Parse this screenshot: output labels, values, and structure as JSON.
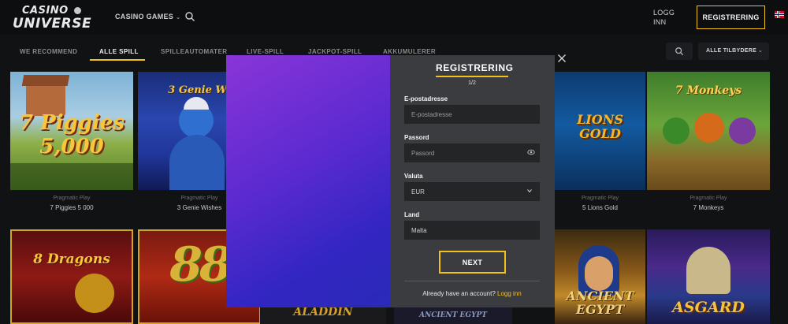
{
  "header": {
    "logo_line1": "CASINO",
    "logo_line2": "UNIVERSE",
    "nav_games": "CASINO GAMES",
    "login": "LOGG INN",
    "register": "REGISTRERING"
  },
  "tabs": [
    {
      "label": "WE RECOMMEND"
    },
    {
      "label": "ALLE SPILL",
      "active": true
    },
    {
      "label": "SPILLEAUTOMATER"
    },
    {
      "label": "LIVE-SPILL"
    },
    {
      "label": "JACKPOT-SPILL"
    },
    {
      "label": "AKKUMULERER"
    }
  ],
  "providers_filter": "ALLE TILBYDERE",
  "games": [
    {
      "provider": "Pragmatic Play",
      "name": "7 Piggies 5 000",
      "art": "7 Piggies 5,000"
    },
    {
      "provider": "Pragmatic Play",
      "name": "3 Genie Wishes",
      "art": "3 Genie Wi"
    },
    {
      "provider": "Pragmatic Play",
      "name": "5 Lions Gold",
      "art": "LIONS GOLD"
    },
    {
      "provider": "Pragmatic Play",
      "name": "7 Monkeys",
      "art": "7 Monkeys"
    },
    {
      "art": "8 Dragons"
    },
    {
      "art": "88"
    },
    {
      "art": "ALADDIN"
    },
    {
      "art": "ANCIENT EGYPT"
    },
    {
      "art": "ANCIENT EGYPT"
    },
    {
      "art": "ASGARD"
    }
  ],
  "modal": {
    "title": "REGISTRERING",
    "step": "1/2",
    "email_label": "E-postadresse",
    "email_placeholder": "E-postadresse",
    "password_label": "Passord",
    "password_placeholder": "Passord",
    "currency_label": "Valuta",
    "currency_value": "EUR",
    "country_label": "Land",
    "country_value": "Malta",
    "next_label": "NEXT",
    "footer_text": "Already have an account?",
    "footer_link": "Logg inn"
  },
  "colors": {
    "accent": "#f2c21b",
    "modal_panel": "#3b3c3f",
    "background": "#111214"
  }
}
